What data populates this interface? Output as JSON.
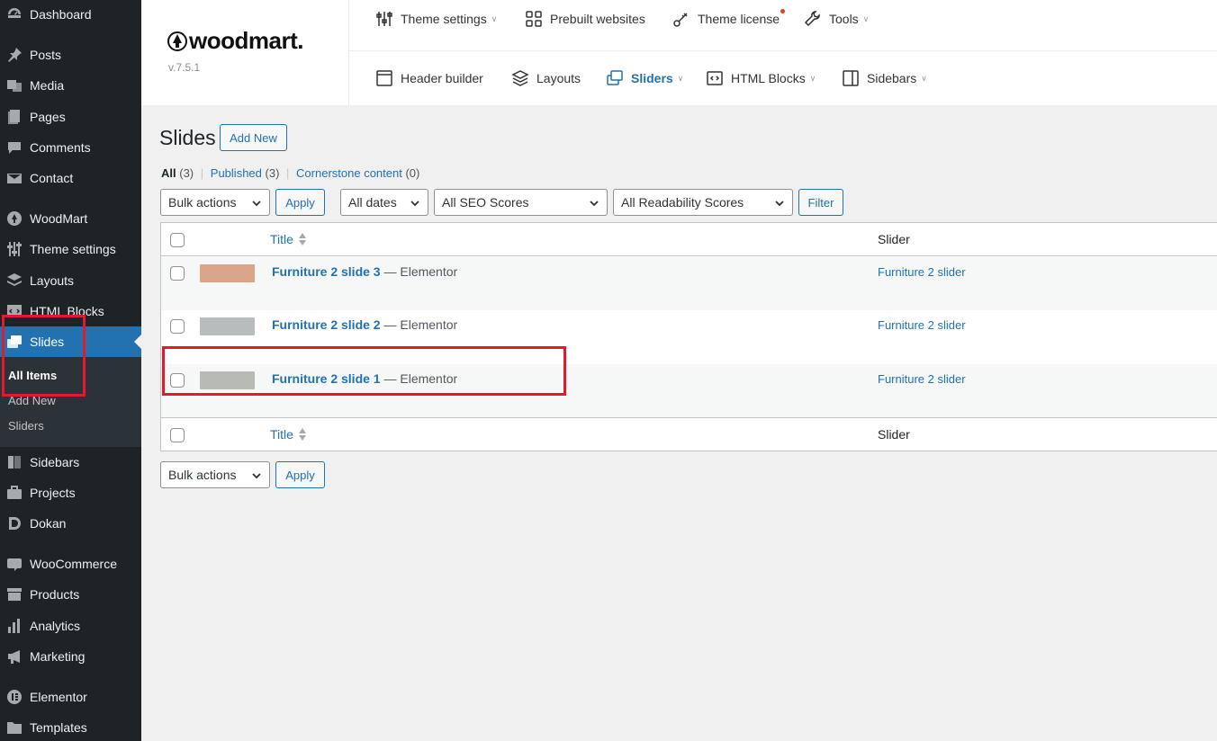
{
  "sidebar": {
    "items": [
      {
        "key": "dashboard",
        "label": "Dashboard",
        "icon": "dashboard-icon"
      },
      {
        "key": "posts",
        "label": "Posts",
        "icon": "pin-icon"
      },
      {
        "key": "media",
        "label": "Media",
        "icon": "media-icon"
      },
      {
        "key": "pages",
        "label": "Pages",
        "icon": "pages-icon"
      },
      {
        "key": "comments",
        "label": "Comments",
        "icon": "comment-icon"
      },
      {
        "key": "contact",
        "label": "Contact",
        "icon": "mail-icon"
      },
      {
        "key": "woodmart",
        "label": "WoodMart",
        "icon": "woodmart-icon"
      },
      {
        "key": "theme-settings",
        "label": "Theme settings",
        "icon": "sliders-icon"
      },
      {
        "key": "layouts",
        "label": "Layouts",
        "icon": "layers-icon"
      },
      {
        "key": "html-blocks",
        "label": "HTML Blocks",
        "icon": "code-icon"
      },
      {
        "key": "slides",
        "label": "Slides",
        "icon": "slides-icon",
        "active": true
      },
      {
        "key": "sidebars",
        "label": "Sidebars",
        "icon": "sidebar-icon"
      },
      {
        "key": "projects",
        "label": "Projects",
        "icon": "briefcase-icon"
      },
      {
        "key": "dokan",
        "label": "Dokan",
        "icon": "dokan-icon"
      },
      {
        "key": "woocommerce",
        "label": "WooCommerce",
        "icon": "woo-icon"
      },
      {
        "key": "products",
        "label": "Products",
        "icon": "archive-icon"
      },
      {
        "key": "analytics",
        "label": "Analytics",
        "icon": "bar-chart-icon"
      },
      {
        "key": "marketing",
        "label": "Marketing",
        "icon": "megaphone-icon"
      },
      {
        "key": "elementor",
        "label": "Elementor",
        "icon": "elementor-icon"
      },
      {
        "key": "templates",
        "label": "Templates",
        "icon": "folder-icon"
      }
    ],
    "submenu": [
      {
        "label": "All Items",
        "current": true
      },
      {
        "label": "Add New"
      },
      {
        "label": "Sliders"
      }
    ]
  },
  "woodmart": {
    "logo": "woodmart.",
    "version": "v.7.5.1",
    "nav_top": [
      {
        "label": "Theme settings",
        "icon": "sliders-icon",
        "caret": true
      },
      {
        "label": "Prebuilt websites",
        "icon": "grid-icon",
        "caret": false
      },
      {
        "label": "Theme license",
        "icon": "key-icon",
        "caret": false,
        "dot": true
      },
      {
        "label": "Tools",
        "icon": "wrench-icon",
        "caret": true
      }
    ],
    "nav_bottom": [
      {
        "label": "Header builder",
        "icon": "header-icon",
        "caret": false
      },
      {
        "label": "Layouts",
        "icon": "layers-icon",
        "caret": false
      },
      {
        "label": "Sliders",
        "icon": "slides-icon",
        "caret": true,
        "active": true
      },
      {
        "label": "HTML Blocks",
        "icon": "code-icon",
        "caret": true
      },
      {
        "label": "Sidebars",
        "icon": "sidebar-icon",
        "caret": true
      }
    ]
  },
  "page": {
    "title": "Slides",
    "add_new": "Add New",
    "filters": {
      "all": "All",
      "all_count": "(3)",
      "published": "Published",
      "published_count": "(3)",
      "cornerstone": "Cornerstone content",
      "cornerstone_count": "(0)",
      "separator": "|"
    },
    "bulk_actions": "Bulk actions",
    "apply": "Apply",
    "dates": "All dates",
    "seo": "All SEO Scores",
    "readability": "All Readability Scores",
    "filter": "Filter"
  },
  "table": {
    "columns": {
      "title": "Title",
      "slider": "Slider"
    },
    "rows": [
      {
        "title": "Furniture 2 slide 3",
        "state": " — Elementor",
        "slider": "Furniture 2 slider",
        "thumb_color": "#d9a487"
      },
      {
        "title": "Furniture 2 slide 2",
        "state": " — Elementor",
        "slider": "Furniture 2 slider",
        "thumb_color": "#b9bcbd"
      },
      {
        "title": "Furniture 2 slide 1",
        "state": " — Elementor",
        "slider": "Furniture 2 slider",
        "thumb_color": "#b7bbb3"
      }
    ]
  },
  "colors": {
    "sidebar_bg": "#1d2327",
    "accent": "#2271b1",
    "highlight": "#e21b2c"
  }
}
